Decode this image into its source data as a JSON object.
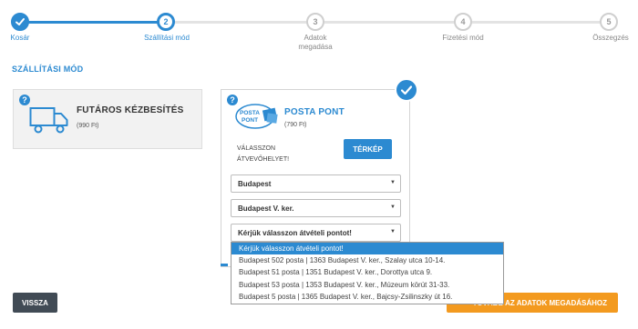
{
  "stepper": {
    "steps": [
      {
        "number": "1",
        "label": "Kosár",
        "state": "done"
      },
      {
        "number": "2",
        "label": "Szállítási mód",
        "state": "current"
      },
      {
        "number": "3",
        "label": "Adatok megadása",
        "state": "todo"
      },
      {
        "number": "4",
        "label": "Fizetési mód",
        "state": "todo"
      },
      {
        "number": "5",
        "label": "Összegzés",
        "state": "todo"
      }
    ]
  },
  "section_title": "SZÁLLÍTÁSI MÓD",
  "courier": {
    "title": "FUTÁROS KÉZBESÍTÉS",
    "price": "(990 Ft)",
    "help": "?",
    "icon": "truck-icon"
  },
  "posta": {
    "title": "POSTA PONT",
    "price": "(790 Ft)",
    "help": "?",
    "logo_text_top": "POSTA",
    "logo_text_bottom": "PONT",
    "choose_text": "VÁLASSZON ÁTVEVŐHELYET!",
    "map_button": "TÉRKÉP",
    "select_city": "Budapest",
    "select_district": "Budapest V. ker.",
    "select_point": "Kérjük válasszon átvételi pontot!"
  },
  "dropdown": {
    "options": [
      "Kérjük válasszon átvételi pontot!",
      "Budapest 502 posta | 1363 Budapest V. ker., Szalay utca 10-14.",
      "Budapest 51 posta | 1351 Budapest V. ker., Dorottya utca 9.",
      "Budapest 53 posta | 1353 Budapest V. ker., Múzeum körút 31-33.",
      "Budapest 5 posta | 1365 Budapest V. ker., Bajcsy-Zsilinszky út 16."
    ],
    "selected_index": 0
  },
  "buttons": {
    "back": "VISSZA",
    "next": "TOVÁBB AZ ADATOK MEGADÁSÁHOZ"
  },
  "colors": {
    "accent": "#2c8ad1",
    "orange": "#f39a1f",
    "dark": "#414b55"
  }
}
